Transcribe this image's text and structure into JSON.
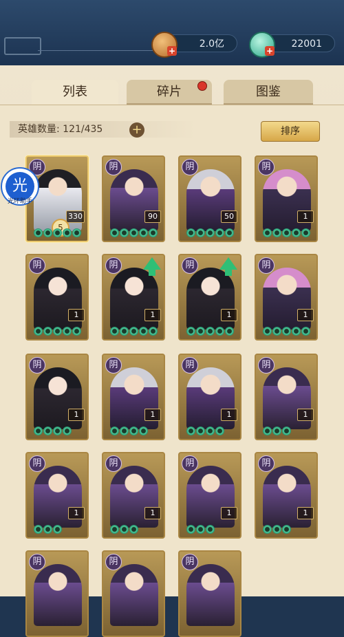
{
  "resources": {
    "gold": "2.0亿",
    "gems": "22001"
  },
  "tabs": [
    {
      "label": "列表",
      "active": true
    },
    {
      "label": "碎片",
      "active": false,
      "badge": true
    },
    {
      "label": "图鉴",
      "active": false
    }
  ],
  "hero_count": "英雄数量: 121/435",
  "sort_label": "排序",
  "badge_label": "光",
  "badge_caption": "光环助手",
  "heroes": [
    {
      "faction": "阴",
      "level": "330",
      "stars": 5,
      "style": "white",
      "rank": "5"
    },
    {
      "faction": "阴",
      "level": "90",
      "stars": 5,
      "style": "purple"
    },
    {
      "faction": "阴",
      "level": "50",
      "stars": 5,
      "style": "silver"
    },
    {
      "faction": "阴",
      "level": "1",
      "stars": 5,
      "style": "pink"
    },
    {
      "faction": "阴",
      "level": "1",
      "stars": 5,
      "style": "black"
    },
    {
      "faction": "阴",
      "level": "1",
      "stars": 5,
      "style": "black",
      "upgrade": true
    },
    {
      "faction": "阴",
      "level": "1",
      "stars": 5,
      "style": "black",
      "upgrade": true
    },
    {
      "faction": "阴",
      "level": "1",
      "stars": 5,
      "style": "pink"
    },
    {
      "faction": "阴",
      "level": "1",
      "stars": 4,
      "style": "black"
    },
    {
      "faction": "阴",
      "level": "1",
      "stars": 4,
      "style": "silver"
    },
    {
      "faction": "阴",
      "level": "1",
      "stars": 4,
      "style": "silver"
    },
    {
      "faction": "阴",
      "level": "1",
      "stars": 3,
      "style": "purple"
    },
    {
      "faction": "阴",
      "level": "1",
      "stars": 3,
      "style": "purple"
    },
    {
      "faction": "阴",
      "level": "1",
      "stars": 3,
      "style": "purple"
    },
    {
      "faction": "阴",
      "level": "1",
      "stars": 3,
      "style": "purple"
    },
    {
      "faction": "阴",
      "level": "1",
      "stars": 3,
      "style": "purple"
    },
    {
      "faction": "阴",
      "level": "",
      "stars": 0,
      "style": "purple"
    },
    {
      "faction": "阴",
      "level": "",
      "stars": 0,
      "style": "purple"
    },
    {
      "faction": "阴",
      "level": "",
      "stars": 0,
      "style": "purple"
    }
  ]
}
